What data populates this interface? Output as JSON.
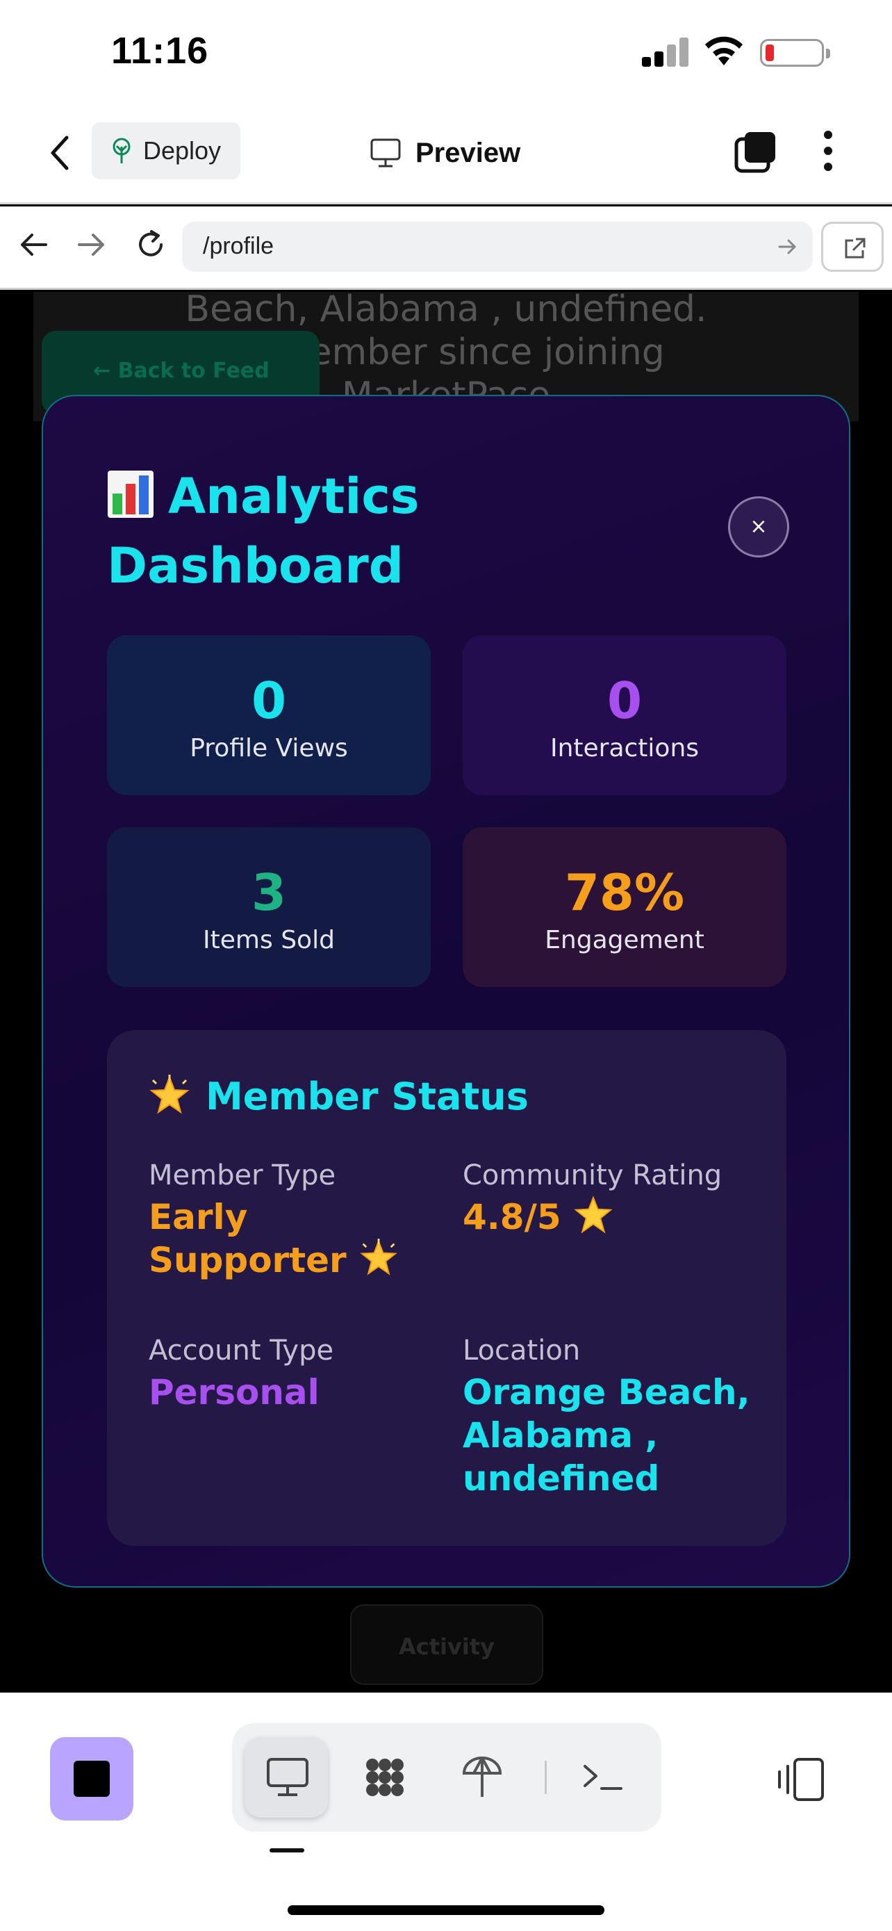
{
  "status_bar": {
    "time": "11:16"
  },
  "app_bar": {
    "deploy_label": "Deploy",
    "preview_label": "Preview"
  },
  "url_bar": {
    "url": "/profile"
  },
  "background": {
    "text_lines": [
      "Beach, Alabama , undefined.",
      "ty member since joining",
      "MarketPace"
    ],
    "back_button": "← Back to Feed",
    "activity_button": "Activity"
  },
  "modal": {
    "title": "Analytics Dashboard",
    "close_label": "×",
    "stats": [
      {
        "value": "0",
        "label": "Profile Views",
        "color": "#19e4ee"
      },
      {
        "value": "0",
        "label": "Interactions",
        "color": "#a84ff0"
      },
      {
        "value": "3",
        "label": "Items Sold",
        "color": "#1fb383"
      },
      {
        "value": "78%",
        "label": "Engagement",
        "color": "#f59e1b"
      }
    ],
    "member_status": {
      "title": "Member Status",
      "member_type": {
        "label": "Member Type",
        "value": "Early Supporter",
        "color": "#f59e1b"
      },
      "community_rating": {
        "label": "Community Rating",
        "value": "4.8/5",
        "color": "#f59e1b"
      },
      "account_type": {
        "label": "Account Type",
        "value": "Personal",
        "color": "#a84ff0"
      },
      "location": {
        "label": "Location",
        "value": "Orange Beach, Alabama , undefined",
        "color": "#19e4ee"
      }
    }
  },
  "colors": {
    "accent": "#19e4ee",
    "modal_border": "#0e6f83",
    "stop_button": "#b9a5ff"
  }
}
